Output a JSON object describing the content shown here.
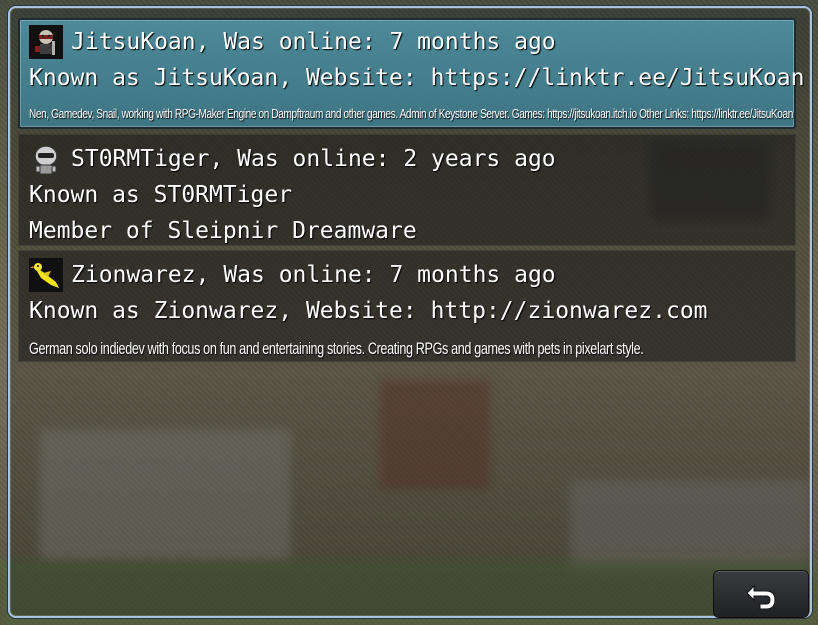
{
  "members": [
    {
      "name_line": "JitsuKoan, Was online: 7 months ago",
      "known_line": "Known as JitsuKoan, Website: https://linktr.ee/JitsuKoan",
      "desc": "Nen, Gamedev, Snail, working with RPG-Maker Engine on Dampftraum and other games. Admin of Keystone Server. Games: https://jitsukoan.itch.io Other Links: https://linktr.ee/JitsuKoan",
      "selected": true
    },
    {
      "name_line": "ST0RMTiger, Was online: 2 years ago",
      "known_line": "Known as ST0RMTiger",
      "desc": "Member of Sleipnir Dreamware",
      "selected": false
    },
    {
      "name_line": "Zionwarez, Was online: 7 months ago",
      "known_line": "Known as Zionwarez, Website: http://zionwarez.com",
      "desc": "German solo indiedev with focus on fun and entertaining stories. Creating RPGs and games with pets in pixelart style.",
      "selected": false
    }
  ],
  "icons": {
    "avatar_1": "ninja-avatar-icon",
    "avatar_2": "robot-avatar-icon",
    "avatar_3": "bird-avatar-icon",
    "back": "back-arrow-icon"
  },
  "colors": {
    "selected_row": "#4f97ab",
    "window_border": "#a9c4de",
    "text": "#ffffff"
  }
}
